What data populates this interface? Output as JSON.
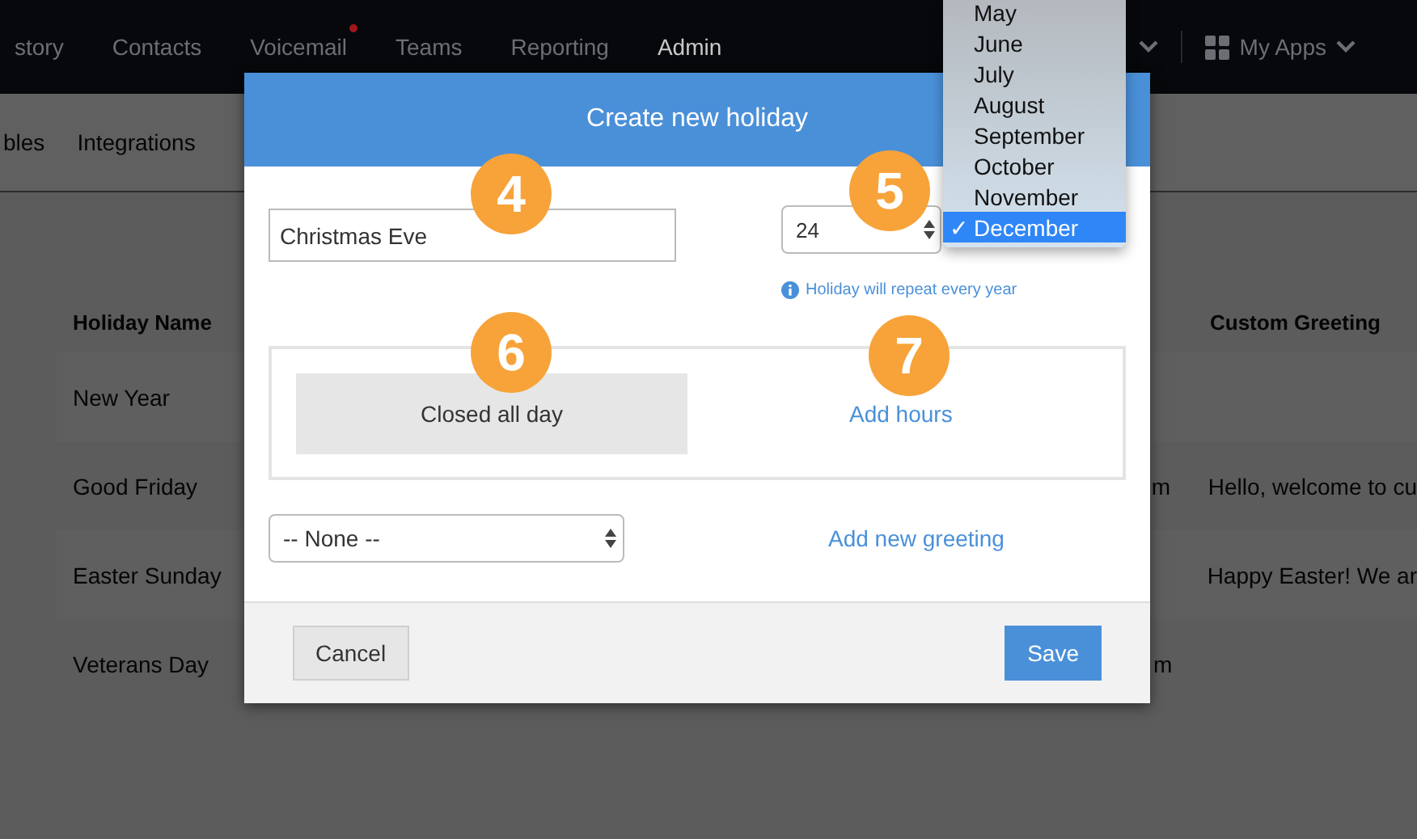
{
  "top_nav": {
    "items": [
      {
        "label": "story",
        "selected": false,
        "notification": false
      },
      {
        "label": "Contacts",
        "selected": false,
        "notification": false
      },
      {
        "label": "Voicemail",
        "selected": false,
        "notification": true
      },
      {
        "label": "Teams",
        "selected": false,
        "notification": false
      },
      {
        "label": "Reporting",
        "selected": false,
        "notification": false
      },
      {
        "label": "Admin",
        "selected": true,
        "notification": false
      }
    ],
    "apps_label": "My Apps"
  },
  "sub_nav": {
    "items": [
      {
        "label": "bles"
      },
      {
        "label": "Integrations"
      }
    ]
  },
  "table": {
    "columns": [
      {
        "label": "Holiday Name"
      },
      {
        "label": "Custom Greeting"
      }
    ],
    "rows": [
      {
        "name": "New Year",
        "column_3": "",
        "greeting": ""
      },
      {
        "name": "Good Friday",
        "column_3": "m",
        "greeting": "Hello, welcome to cu"
      },
      {
        "name": "Easter Sunday",
        "column_3": "",
        "greeting": "Happy Easter! We ar"
      },
      {
        "name": "Veterans Day",
        "column_3": "m",
        "greeting": ""
      }
    ]
  },
  "dialog": {
    "title": "Create new holiday",
    "name_value": "Christmas Eve",
    "day_value": "24",
    "hint": "Holiday will repeat every year",
    "hours_options": [
      {
        "label": "Closed all day",
        "selected": true
      },
      {
        "label": "Add hours",
        "selected": false
      }
    ],
    "greeting_select": "-- None --",
    "greeting_link": "Add new greeting",
    "buttons": [
      {
        "label": "Cancel",
        "kind": "secondary"
      },
      {
        "label": "Save",
        "kind": "primary"
      }
    ]
  },
  "month_menu": {
    "items": [
      {
        "label": "May",
        "selected": false
      },
      {
        "label": "June",
        "selected": false
      },
      {
        "label": "July",
        "selected": false
      },
      {
        "label": "August",
        "selected": false
      },
      {
        "label": "September",
        "selected": false
      },
      {
        "label": "October",
        "selected": false
      },
      {
        "label": "November",
        "selected": false
      },
      {
        "label": "December",
        "selected": true
      }
    ],
    "check": "✓"
  },
  "callouts": [
    {
      "number": "4"
    },
    {
      "number": "5"
    },
    {
      "number": "6"
    },
    {
      "number": "7"
    }
  ]
}
